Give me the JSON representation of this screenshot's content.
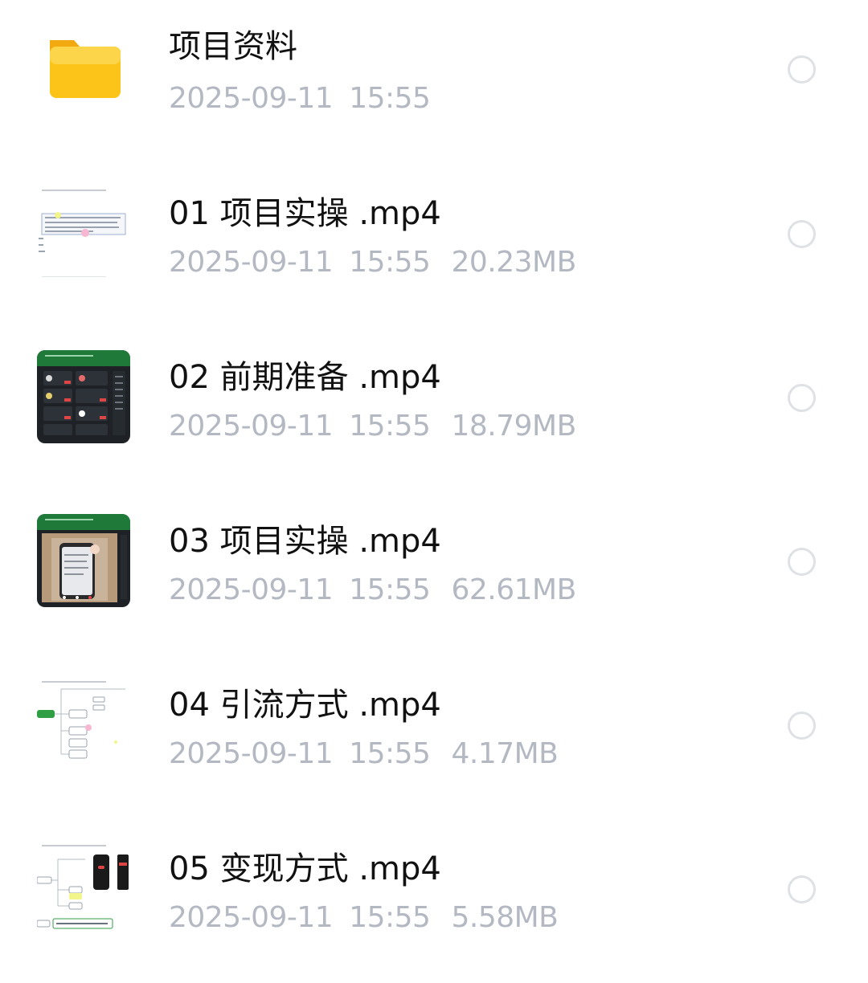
{
  "files": [
    {
      "name": "项目资料",
      "date": "2025-09-11",
      "time": "15:55",
      "size": "",
      "icon": "folder-icon"
    },
    {
      "name": "01 项目实操 .mp4",
      "date": "2025-09-11",
      "time": "15:55",
      "size": "20.23MB",
      "icon": "video-thumbnail-document"
    },
    {
      "name": "02 前期准备 .mp4",
      "date": "2025-09-11",
      "time": "15:55",
      "size": "18.79MB",
      "icon": "video-thumbnail-dark-app"
    },
    {
      "name": "03 项目实操 .mp4",
      "date": "2025-09-11",
      "time": "15:55",
      "size": "62.61MB",
      "icon": "video-thumbnail-phone"
    },
    {
      "name": "04 引流方式 .mp4",
      "date": "2025-09-11",
      "time": "15:55",
      "size": "4.17MB",
      "icon": "video-thumbnail-mindmap"
    },
    {
      "name": "05 变现方式 .mp4",
      "date": "2025-09-11",
      "time": "15:55",
      "size": "5.58MB",
      "icon": "video-thumbnail-mindmap-phone"
    }
  ],
  "colors": {
    "name_text": "#111111",
    "meta_text": "#b3b8c2",
    "radio_border": "#dfe1e5",
    "folder_yellow": "#fcc419",
    "thumb_green": "#1f7a3a",
    "thumb_dark": "#1e2226"
  }
}
